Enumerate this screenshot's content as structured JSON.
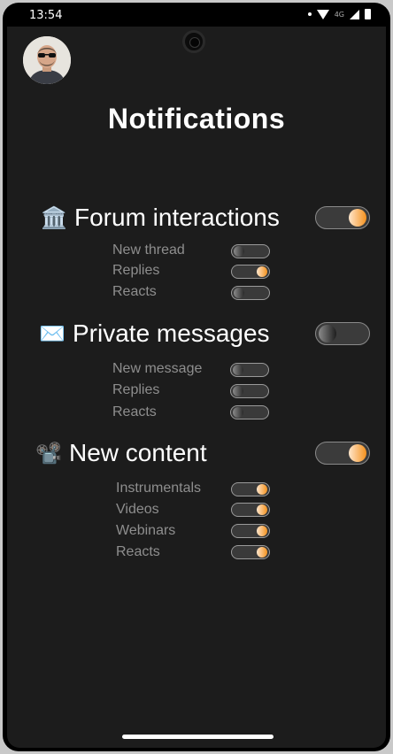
{
  "status_bar": {
    "time": "13:54",
    "network": "4G"
  },
  "title": "Notifications",
  "sections": [
    {
      "icon": "classical-building-icon",
      "emoji": "🏛️",
      "label": "Forum interactions",
      "enabled": true,
      "items": [
        {
          "label": "New thread",
          "enabled": false
        },
        {
          "label": "Replies",
          "enabled": true
        },
        {
          "label": "Reacts",
          "enabled": false
        }
      ]
    },
    {
      "icon": "envelope-icon",
      "emoji": "✉️",
      "label": "Private messages",
      "enabled": false,
      "items": [
        {
          "label": "New message",
          "enabled": false
        },
        {
          "label": "Replies",
          "enabled": false
        },
        {
          "label": "Reacts",
          "enabled": false
        }
      ]
    },
    {
      "icon": "film-projector-icon",
      "emoji": "📽️",
      "label": "New content",
      "enabled": true,
      "items": [
        {
          "label": "Instrumentals",
          "enabled": true
        },
        {
          "label": "Videos",
          "enabled": true
        },
        {
          "label": "Webinars",
          "enabled": true
        },
        {
          "label": "Reacts",
          "enabled": true
        }
      ]
    }
  ],
  "colors": {
    "accent": "#f4921e",
    "background": "#1c1c1c",
    "muted_text": "#8e8e8e"
  }
}
